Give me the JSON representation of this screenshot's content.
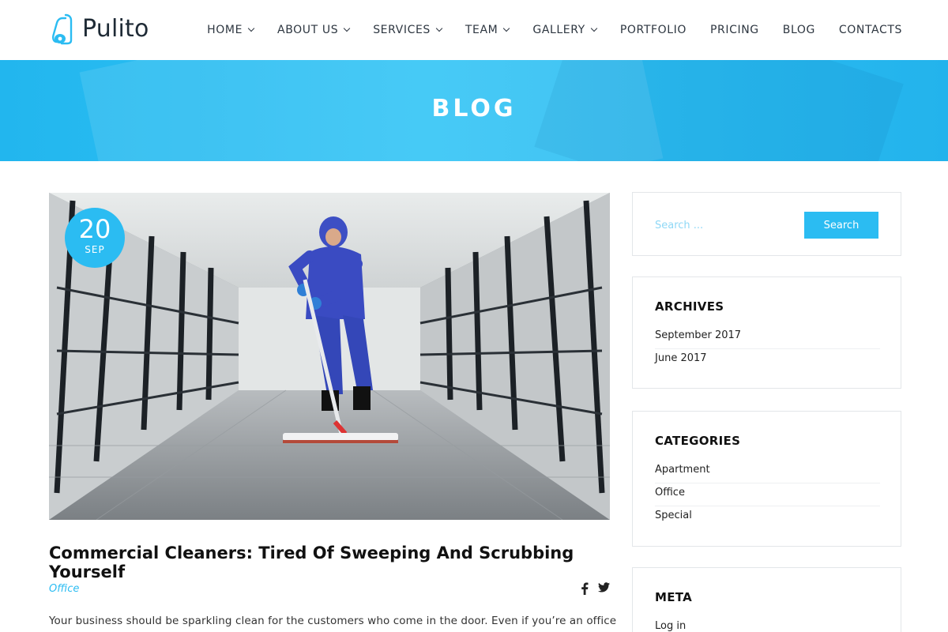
{
  "site": {
    "name": "Pulito"
  },
  "nav": {
    "items": [
      {
        "label": "HOME",
        "dropdown": true
      },
      {
        "label": "ABOUT US",
        "dropdown": true
      },
      {
        "label": "SERVICES",
        "dropdown": true
      },
      {
        "label": "TEAM",
        "dropdown": true
      },
      {
        "label": "GALLERY",
        "dropdown": true
      },
      {
        "label": "PORTFOLIO",
        "dropdown": false
      },
      {
        "label": "PRICING",
        "dropdown": false
      },
      {
        "label": "BLOG",
        "dropdown": false
      },
      {
        "label": "CONTACTS",
        "dropdown": false
      }
    ]
  },
  "banner": {
    "title": "BLOG"
  },
  "post": {
    "day": "20",
    "month": "SEP",
    "title": "Commercial Cleaners: Tired Of Sweeping And Scrubbing Yourself",
    "category": "Office",
    "excerpt": "Your business should be sparkling clean for the customers who come in the door. Even if you’re an office",
    "share_icons": [
      "facebook-icon",
      "twitter-icon"
    ]
  },
  "sidebar": {
    "search": {
      "placeholder": "Search ...",
      "button_label": "Search"
    },
    "archives": {
      "title": "ARCHIVES",
      "items": [
        "September 2017",
        "June 2017"
      ]
    },
    "categories": {
      "title": "CATEGORIES",
      "items": [
        "Apartment",
        "Office",
        "Special"
      ]
    },
    "meta": {
      "title": "META",
      "items": [
        "Log in"
      ]
    }
  },
  "colors": {
    "accent": "#2bbcf2",
    "banner": "#32c4f5",
    "text": "#222222"
  }
}
